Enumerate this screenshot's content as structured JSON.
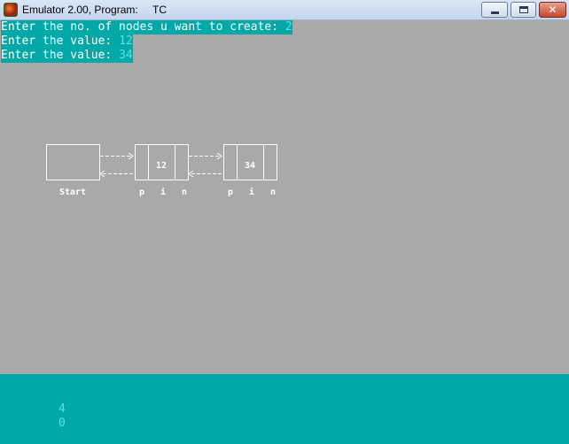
{
  "window": {
    "title": "Emulator 2.00, Program:",
    "program": "TC",
    "buttons": {
      "minimize": "minimize",
      "maximize": "maximize",
      "close": "✕"
    }
  },
  "console": {
    "lines": [
      {
        "prompt": "Enter the no. of nodes u want to create: ",
        "value": "2"
      },
      {
        "prompt": "Enter the value: ",
        "value": "12"
      },
      {
        "prompt": "Enter the value: ",
        "value": "34"
      }
    ]
  },
  "diagram": {
    "start_label": "Start",
    "nodes": [
      {
        "value": "12",
        "labels": [
          "p",
          "i",
          "n"
        ]
      },
      {
        "value": "34",
        "labels": [
          "p",
          "i",
          "n"
        ]
      }
    ]
  },
  "output": {
    "lines": [
      "4",
      "0"
    ]
  },
  "colors": {
    "background": "#a9a9a9",
    "cyan": "#00a8a8",
    "light_cyan": "#55e3e3",
    "white": "#ffffff"
  }
}
